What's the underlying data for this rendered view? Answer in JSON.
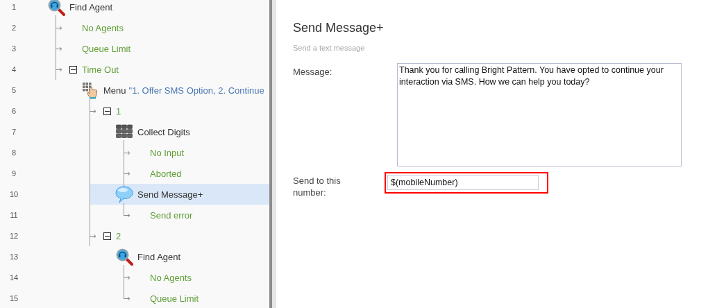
{
  "tree": {
    "rows": [
      {
        "line": "1",
        "kind": "find-agent",
        "label": "Find Agent",
        "selected": false,
        "children": [
          {
            "line": "2",
            "kind": "exit",
            "label": "No Agents",
            "selected": false
          },
          {
            "line": "3",
            "kind": "exit",
            "label": "Queue Limit",
            "selected": false
          },
          {
            "line": "4",
            "kind": "exit",
            "label": "Time Out",
            "selected": false,
            "expanded": true,
            "children": [
              {
                "line": "5",
                "kind": "menu",
                "label": "Menu",
                "detail": "\"1. Offer SMS Option, 2. Continue",
                "selected": false,
                "children": [
                  {
                    "line": "6",
                    "kind": "exit",
                    "label": "1",
                    "selected": false,
                    "expanded": true,
                    "children": [
                      {
                        "line": "7",
                        "kind": "collect-digits",
                        "label": "Collect Digits",
                        "selected": false,
                        "children": [
                          {
                            "line": "8",
                            "kind": "exit",
                            "label": "No Input",
                            "selected": false
                          },
                          {
                            "line": "9",
                            "kind": "exit",
                            "label": "Aborted",
                            "selected": false
                          }
                        ]
                      },
                      {
                        "line": "10",
                        "kind": "send-message",
                        "label": "Send Message+",
                        "selected": true,
                        "children": [
                          {
                            "line": "11",
                            "kind": "exit",
                            "label": "Send error",
                            "selected": false
                          }
                        ]
                      }
                    ]
                  },
                  {
                    "line": "12",
                    "kind": "exit",
                    "label": "2",
                    "selected": false,
                    "expanded": true,
                    "children": [
                      {
                        "line": "13",
                        "kind": "find-agent",
                        "label": "Find Agent",
                        "selected": false,
                        "children": [
                          {
                            "line": "14",
                            "kind": "exit",
                            "label": "No Agents",
                            "selected": false
                          },
                          {
                            "line": "15",
                            "kind": "exit",
                            "label": "Queue Limit",
                            "selected": false
                          }
                        ]
                      }
                    ]
                  }
                ]
              }
            ]
          }
        ]
      }
    ]
  },
  "editor": {
    "title": "Send Message+",
    "subtitle": "Send a text message",
    "fields": [
      {
        "kind": "textarea",
        "label": "Message:",
        "value": "Thank you for calling Bright Pattern. You have opted to continue your interaction via SMS. How we can help you today?"
      },
      {
        "kind": "text",
        "label": "Send to this number:",
        "value": "$(mobileNumber)",
        "highlighted": true
      }
    ]
  }
}
